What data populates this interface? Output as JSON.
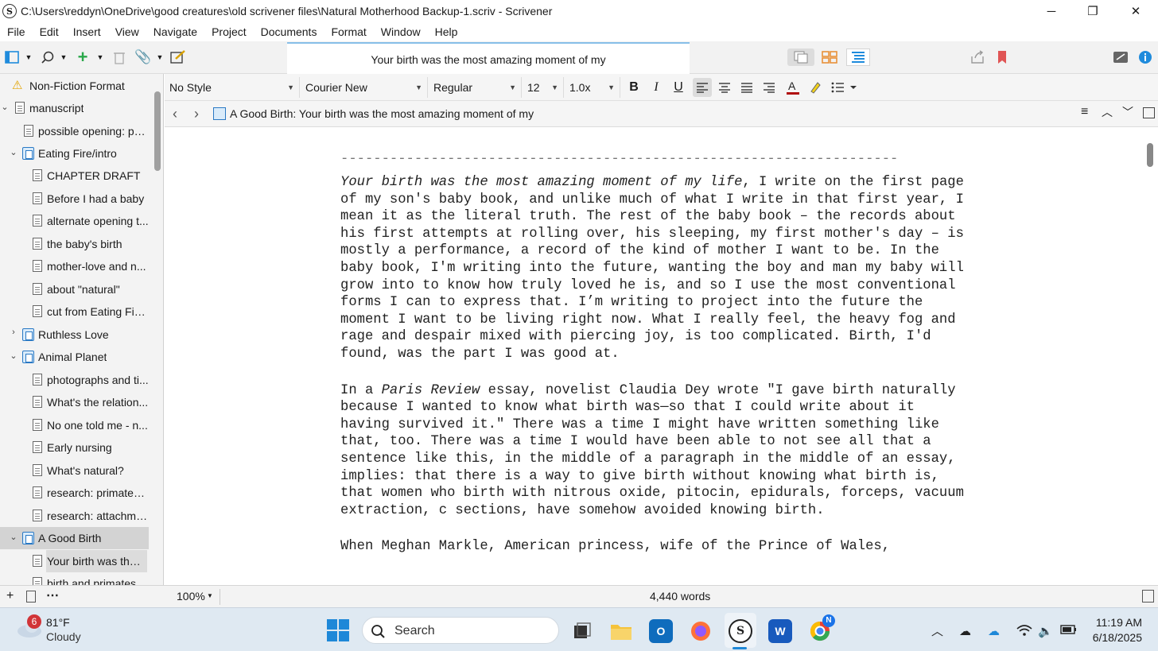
{
  "window": {
    "title": "C:\\Users\\reddyn\\OneDrive\\good creatures\\old scrivener files\\Natural Motherhood Backup-1.scriv - Scrivener",
    "minimize": "─",
    "maximize": "❐",
    "close": "✕"
  },
  "menu": [
    "File",
    "Edit",
    "Insert",
    "View",
    "Navigate",
    "Project",
    "Documents",
    "Format",
    "Window",
    "Help"
  ],
  "toolbar": {
    "doc_title": "Your birth was the most amazing moment of my"
  },
  "binder": {
    "items": [
      {
        "label": "Non-Fiction Format"
      },
      {
        "label": "manuscript"
      },
      {
        "label": "possible opening: ph..."
      },
      {
        "label": "Eating Fire/intro"
      },
      {
        "label": "CHAPTER DRAFT"
      },
      {
        "label": "Before I had a baby"
      },
      {
        "label": "alternate opening t..."
      },
      {
        "label": "the baby's birth"
      },
      {
        "label": "mother-love and n..."
      },
      {
        "label": "about \"natural\""
      },
      {
        "label": "cut from Eating Fire..."
      },
      {
        "label": "Ruthless Love"
      },
      {
        "label": "Animal Planet"
      },
      {
        "label": "photographs and ti..."
      },
      {
        "label": "What's the relation..."
      },
      {
        "label": "No one told me - n..."
      },
      {
        "label": "Early nursing"
      },
      {
        "label": "What's natural?"
      },
      {
        "label": "research: primates ..."
      },
      {
        "label": "research: attachme..."
      },
      {
        "label": "A Good Birth"
      },
      {
        "label": "Your birth was the ..."
      },
      {
        "label": "birth and primates"
      }
    ]
  },
  "format": {
    "style": "No Style",
    "font": "Courier New",
    "weight": "Regular",
    "size": "12",
    "spacing": "1.0x",
    "bold": "B",
    "italic": "I",
    "underline": "U"
  },
  "header": {
    "path": "A Good Birth: Your birth was the most amazing moment of my"
  },
  "editor": {
    "separator": "--------------------------------------------------------------------",
    "p1_italic": "Your birth was the most amazing moment of my life",
    "p1_rest": ", I write on the first page of my son's baby book, and unlike much of what I write in that first year, I mean it as the literal truth. The rest of the baby book – the records about his first attempts at rolling over, his sleeping, my first mother's day – is mostly a performance, a record of the kind of mother I want to be. In the baby book, I'm writing into the future, wanting the boy and man my baby will grow into to know how truly loved he is, and so I use the most conventional forms I can to express that. I’m writing to project into the future the moment I want to be living right now. What I really feel, the heavy fog and rage and despair mixed with piercing joy, is too complicated. Birth, I'd found, was the part I was good at.",
    "p2_a": "In a ",
    "p2_italic": "Paris Review",
    "p2_b": " essay, novelist Claudia Dey wrote \"I gave birth naturally because I wanted to know what birth was—so that I could write about it having survived it.\" There was a time I might have written something like that, too. There was a time I would have been able to not see all that a sentence like this, in the middle of a paragraph in the middle of an essay, implies: that there is a way to give birth without knowing what birth is, that women who birth with nitrous oxide, pitocin, epidurals, forceps, vacuum extraction, c sections, have somehow avoided knowing birth.",
    "p3": "When Meghan Markle, American princess, wife of the Prince of Wales,"
  },
  "footer": {
    "zoom": "100%",
    "word_count": "4,440 words"
  },
  "taskbar": {
    "weather_badge": "6",
    "temp": "81°F",
    "condition": "Cloudy",
    "search": "Search",
    "time": "11:19 AM",
    "date": "6/18/2025",
    "chrome_badge": "N"
  },
  "colors": {
    "accent": "#1f8bdc",
    "selection": "#d3d3d3",
    "taskbar": "#dfe9f2"
  }
}
